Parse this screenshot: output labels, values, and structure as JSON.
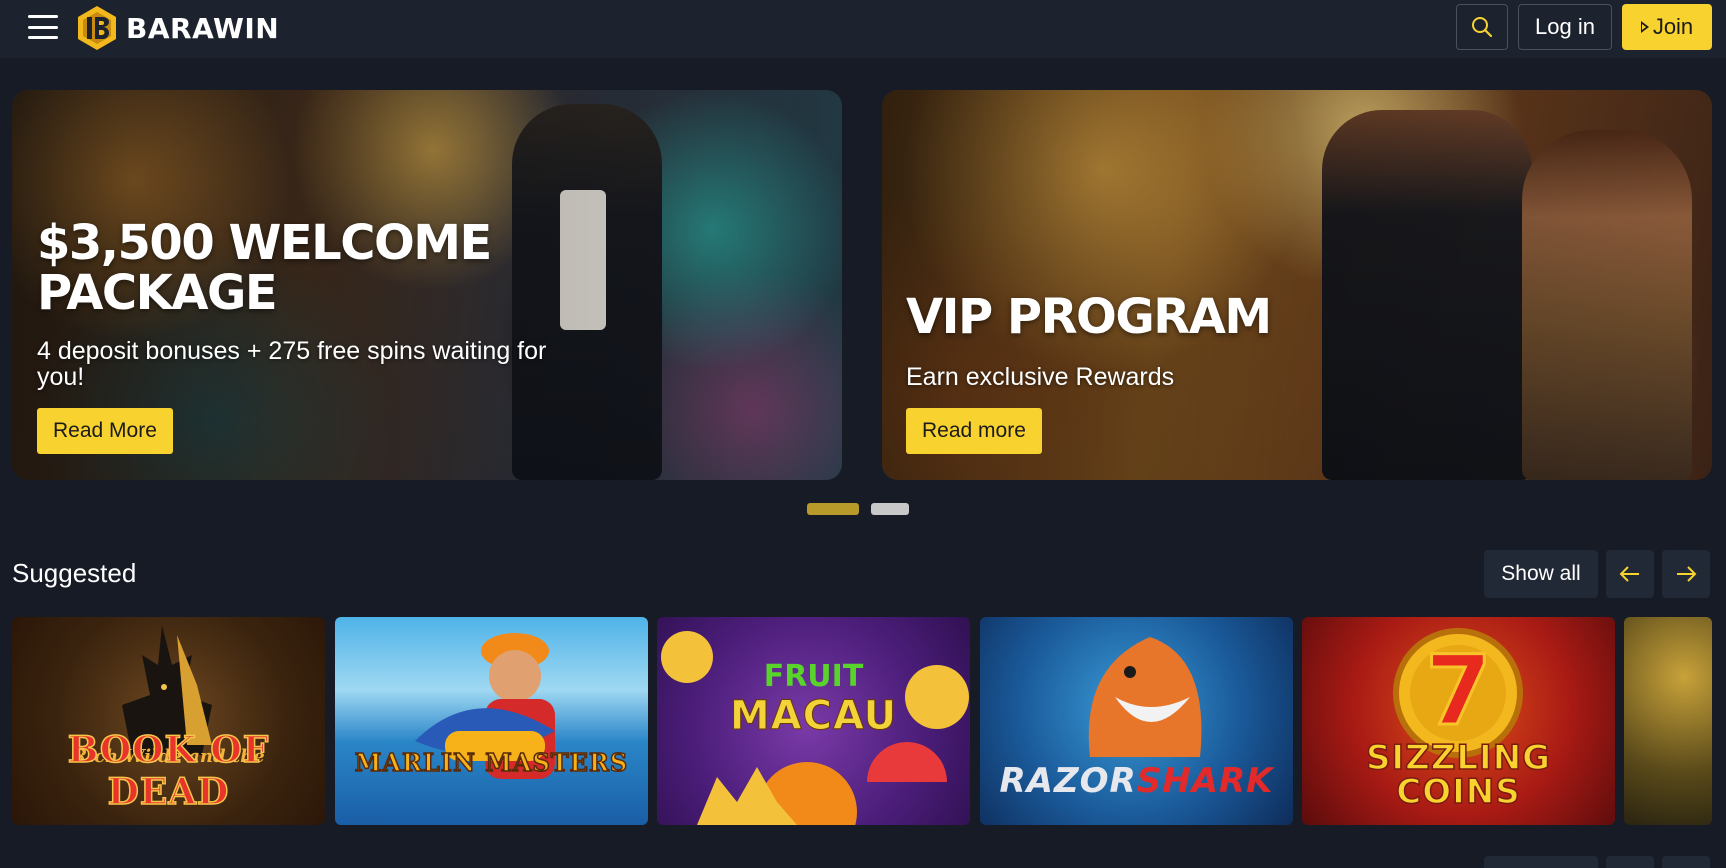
{
  "header": {
    "brand": "BARAWIN",
    "login_label": "Log in",
    "join_label": "Join",
    "accent": "#f8d22f",
    "icons": [
      "hamburger-menu-icon",
      "search-icon",
      "play-icon"
    ]
  },
  "banners": [
    {
      "title": "$3,500 WELCOME PACKAGE",
      "subtitle": "4 deposit bonuses + 275 free spins waiting for you!",
      "button": "Read More"
    },
    {
      "title": "VIP PROGRAM",
      "subtitle": "Earn exclusive Rewards",
      "button": "Read more"
    }
  ],
  "carousel": {
    "active_index": 0,
    "count": 2
  },
  "suggested": {
    "title": "Suggested",
    "show_all": "Show all",
    "games": [
      {
        "title": "BOOK OF DEAD",
        "subtitle": "Rich Wilde and the"
      },
      {
        "title": "MARLIN MASTERS"
      },
      {
        "title": "MACAU",
        "subtitle": "FRUIT"
      },
      {
        "title_a": "RAZOR",
        "title_b": "SHARK"
      },
      {
        "title": "SIZZLING COINS",
        "symbol": "7"
      }
    ]
  }
}
